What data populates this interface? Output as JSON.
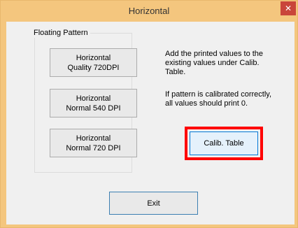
{
  "window": {
    "title": "Horizontal",
    "close_glyph": "✕"
  },
  "group": {
    "label": "Floating Pattern",
    "buttons": [
      {
        "line1": "Horizontal",
        "line2": "Quality 720DPI"
      },
      {
        "line1": "Horizontal",
        "line2": "Normal 540 DPI"
      },
      {
        "line1": "Horizontal",
        "line2": "Normal 720 DPI"
      }
    ]
  },
  "instructions": {
    "text1": "Add the printed values to the\nexisting values under Calib.\nTable.",
    "text2": "If pattern is calibrated correctly,\nall values should print 0."
  },
  "calib_button": {
    "label": "Calib. Table"
  },
  "exit_button": {
    "label": "Exit"
  },
  "colors": {
    "frame": "#f4c67e",
    "close": "#c9453a",
    "highlight": "#ff0000",
    "client": "#f0f0f0"
  }
}
